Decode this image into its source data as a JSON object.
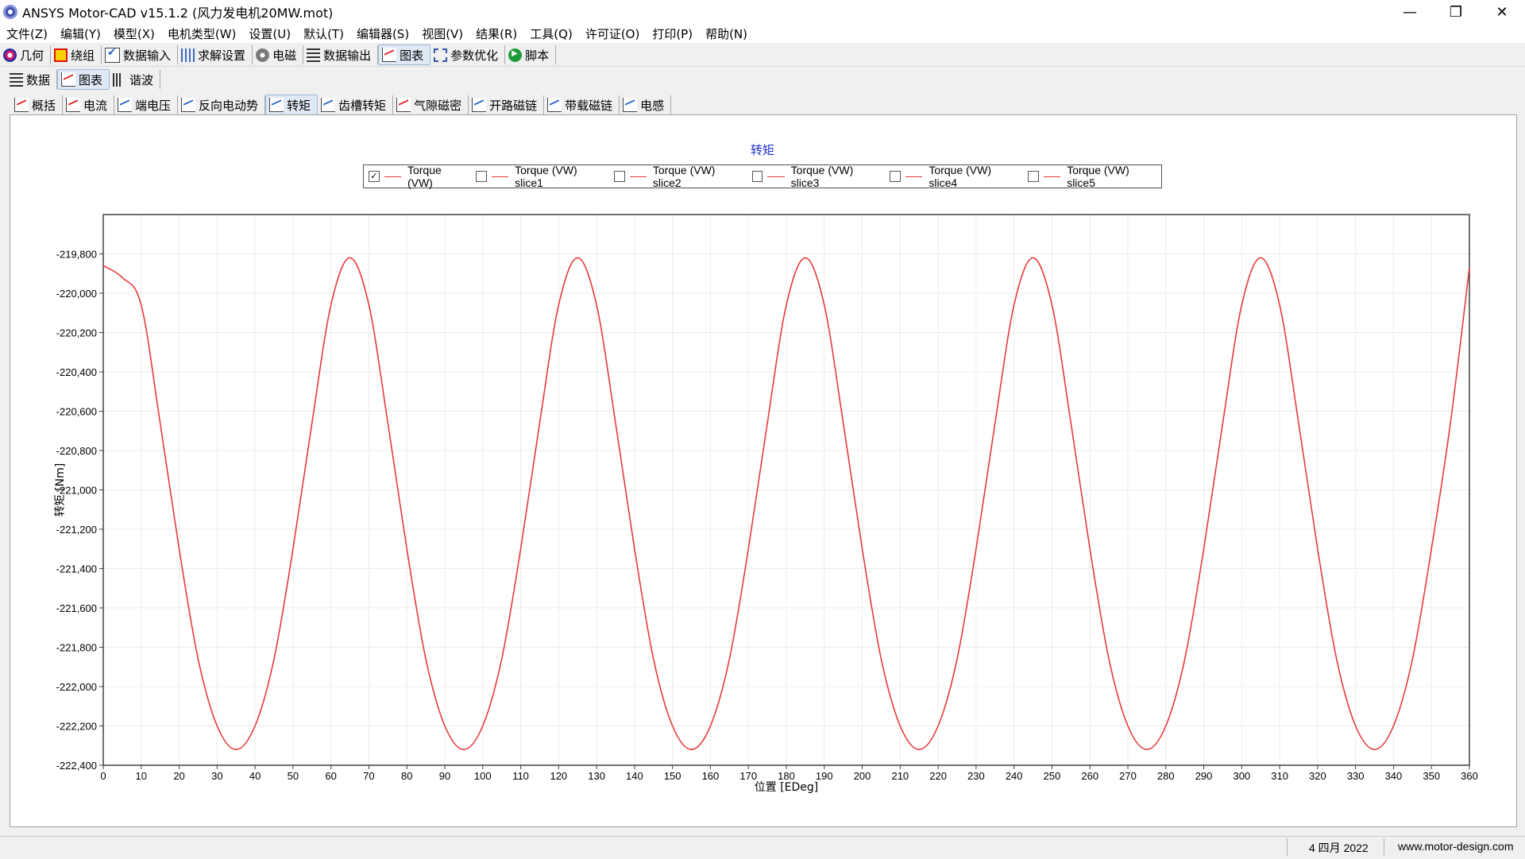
{
  "window": {
    "title": "ANSYS Motor-CAD v15.1.2 (风力发电机20MW.mot)",
    "controls": [
      "—",
      "❐",
      "✕"
    ]
  },
  "menu": [
    "文件(Z)",
    "编辑(Y)",
    "模型(X)",
    "电机类型(W)",
    "设置(U)",
    "默认(T)",
    "编辑器(S)",
    "视图(V)",
    "结果(R)",
    "工具(Q)",
    "许可证(O)",
    "打印(P)",
    "帮助(N)"
  ],
  "main_toolbar": [
    {
      "label": "几何",
      "icon": "geometry-icon"
    },
    {
      "label": "绕组",
      "icon": "winding-icon"
    },
    {
      "label": "数据输入",
      "icon": "input-data-icon"
    },
    {
      "label": "求解设置",
      "icon": "solve-settings-icon"
    },
    {
      "label": "电磁",
      "icon": "electromagnetic-icon"
    },
    {
      "label": "数据输出",
      "icon": "output-data-icon"
    },
    {
      "label": "图表",
      "icon": "graph-icon",
      "active": true
    },
    {
      "label": "参数优化",
      "icon": "optimisation-icon"
    },
    {
      "label": "脚本",
      "icon": "script-icon"
    }
  ],
  "sub_tabs": [
    {
      "label": "数据",
      "icon": "list-icon"
    },
    {
      "label": "图表",
      "icon": "graph-icon",
      "active": true
    },
    {
      "label": "谐波",
      "icon": "harmonics-icon"
    }
  ],
  "chart_tabs": [
    {
      "label": "概括",
      "icon": "red-chart-icon"
    },
    {
      "label": "电流",
      "icon": "red-chart-icon"
    },
    {
      "label": "端电压",
      "icon": "blue-chart-icon"
    },
    {
      "label": "反向电动势",
      "icon": "blue-chart-icon"
    },
    {
      "label": "转矩",
      "icon": "blue-chart-icon",
      "active": true
    },
    {
      "label": "齿槽转矩",
      "icon": "blue-chart-icon"
    },
    {
      "label": "气隙磁密",
      "icon": "red-chart-icon"
    },
    {
      "label": "开路磁链",
      "icon": "blue-chart-icon"
    },
    {
      "label": "带载磁链",
      "icon": "blue-chart-icon"
    },
    {
      "label": "电感",
      "icon": "blue-chart-icon"
    }
  ],
  "legend": [
    {
      "label": "Torque (VW)",
      "checked": true
    },
    {
      "label": "Torque (VW) slice1",
      "checked": false
    },
    {
      "label": "Torque (VW) slice2",
      "checked": false
    },
    {
      "label": "Torque (VW) slice3",
      "checked": false
    },
    {
      "label": "Torque (VW) slice4",
      "checked": false
    },
    {
      "label": "Torque (VW) slice5",
      "checked": false
    }
  ],
  "chart_data": {
    "type": "line",
    "title": "转矩",
    "xlabel": "位置 [EDeg]",
    "ylabel": "转矩 [Nm]",
    "xlim": [
      0,
      360
    ],
    "ylim": [
      -222400,
      -219600
    ],
    "x_ticks": [
      0,
      10,
      20,
      30,
      40,
      50,
      60,
      70,
      80,
      90,
      100,
      110,
      120,
      130,
      140,
      150,
      160,
      170,
      180,
      190,
      200,
      210,
      220,
      230,
      240,
      250,
      260,
      270,
      280,
      290,
      300,
      310,
      320,
      330,
      340,
      350,
      360
    ],
    "y_ticks": [
      -219800,
      -220000,
      -220200,
      -220400,
      -220600,
      -220800,
      -221000,
      -221200,
      -221400,
      -221600,
      -221800,
      -222000,
      -222200,
      -222400
    ],
    "y_tick_labels": [
      "-219,800",
      "-220,000",
      "-220,200",
      "-220,400",
      "-220,600",
      "-220,800",
      "-221,000",
      "-221,200",
      "-221,400",
      "-221,600",
      "-221,800",
      "-222,000",
      "-222,200",
      "-222,400"
    ],
    "grid": true,
    "line_color": "#e83a3a",
    "series": [
      {
        "name": "Torque (VW)",
        "x": [
          0,
          5,
          10,
          15,
          20,
          25,
          30,
          35,
          40,
          45,
          50,
          55,
          60,
          65,
          70,
          75,
          80,
          85,
          90,
          95,
          100,
          105,
          110,
          115,
          120,
          125,
          130,
          135,
          140,
          145,
          150,
          155,
          160,
          165,
          170,
          175,
          180,
          185,
          190,
          195,
          200,
          205,
          210,
          215,
          220,
          225,
          230,
          235,
          240,
          245,
          250,
          255,
          260,
          265,
          270,
          275,
          280,
          285,
          290,
          295,
          300,
          305,
          310,
          315,
          320,
          325,
          330,
          335,
          340,
          345,
          350,
          355,
          360
        ],
        "y": [
          -219860,
          -219920,
          -220060,
          -220660,
          -221300,
          -221860,
          -222200,
          -222320,
          -222200,
          -221860,
          -221300,
          -220660,
          -220060,
          -219820,
          -220060,
          -220660,
          -221300,
          -221860,
          -222200,
          -222320,
          -222200,
          -221860,
          -221300,
          -220660,
          -220060,
          -219820,
          -220060,
          -220660,
          -221300,
          -221860,
          -222200,
          -222320,
          -222200,
          -221860,
          -221300,
          -220660,
          -220060,
          -219820,
          -220060,
          -220660,
          -221300,
          -221860,
          -222200,
          -222320,
          -222200,
          -221860,
          -221300,
          -220660,
          -220060,
          -219820,
          -220060,
          -220660,
          -221300,
          -221860,
          -222200,
          -222320,
          -222200,
          -221860,
          -221300,
          -220660,
          -220060,
          -219820,
          -220060,
          -220660,
          -221300,
          -221860,
          -222200,
          -222320,
          -222200,
          -221860,
          -221300,
          -220660,
          -219870
        ]
      }
    ]
  },
  "status": {
    "date": "4 四月 2022",
    "website": "www.motor-design.com"
  }
}
